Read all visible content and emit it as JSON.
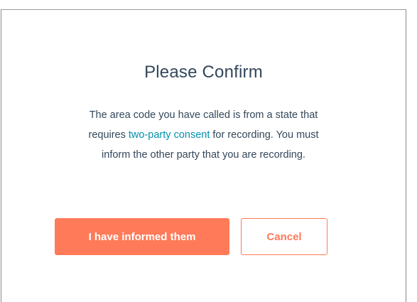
{
  "dialog": {
    "title": "Please Confirm",
    "body": {
      "line1": "The area code you have called is from a state that",
      "line2_prefix": "requires ",
      "line2_link": "two-party consent",
      "line2_suffix": " for recording. You must",
      "line3": "inform the other party that you are recording."
    },
    "buttons": {
      "confirm_label": "I have informed them",
      "cancel_label": "Cancel"
    }
  },
  "colors": {
    "accent": "#ff7a59",
    "link": "#0091ae",
    "text": "#33475b"
  }
}
